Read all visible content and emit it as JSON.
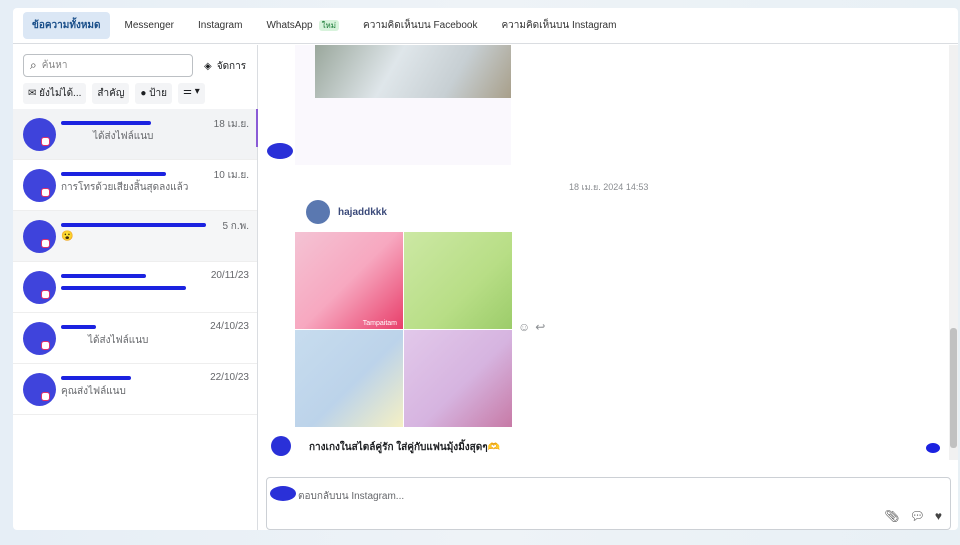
{
  "tabs": [
    {
      "label": "ข้อความทั้งหมด",
      "active": true
    },
    {
      "label": "Messenger"
    },
    {
      "label": "Instagram"
    },
    {
      "label": "WhatsApp",
      "badge": "ใหม่"
    },
    {
      "label": "ความคิดเห็นบน Facebook"
    },
    {
      "label": "ความคิดเห็นบน Instagram"
    }
  ],
  "search": {
    "placeholder": "ค้นหา"
  },
  "manage_label": "จัดการ",
  "filters": {
    "unread": "ยังไม่ได้...",
    "important": "สำคัญ",
    "labels": "ป้าย"
  },
  "conversations": [
    {
      "preview": "ได้ส่งไฟล์แนบ",
      "date": "18 เม.ย."
    },
    {
      "preview": "การโทรด้วยเสียงสิ้นสุดลงแล้ว",
      "date": "10 เม.ย."
    },
    {
      "preview": "😮",
      "date": "5 ก.พ."
    },
    {
      "preview": "",
      "date": "20/11/23"
    },
    {
      "preview": "ได้ส่งไฟล์แนบ",
      "date": "24/10/23"
    },
    {
      "preview": "คุณส่งไฟล์แนบ",
      "date": "22/10/23"
    }
  ],
  "chat": {
    "timestamp": "18 เม.ย. 2024 14:53",
    "sender": "hajaddkkk",
    "watermark": "Tampaitam",
    "caption": "กางเกงในสไตล์คู่รัก ใส่คู่กับแฟนมุ้งมิ้งสุดๆ🫶",
    "reply_placeholder": "ตอบกลับบน Instagram..."
  }
}
